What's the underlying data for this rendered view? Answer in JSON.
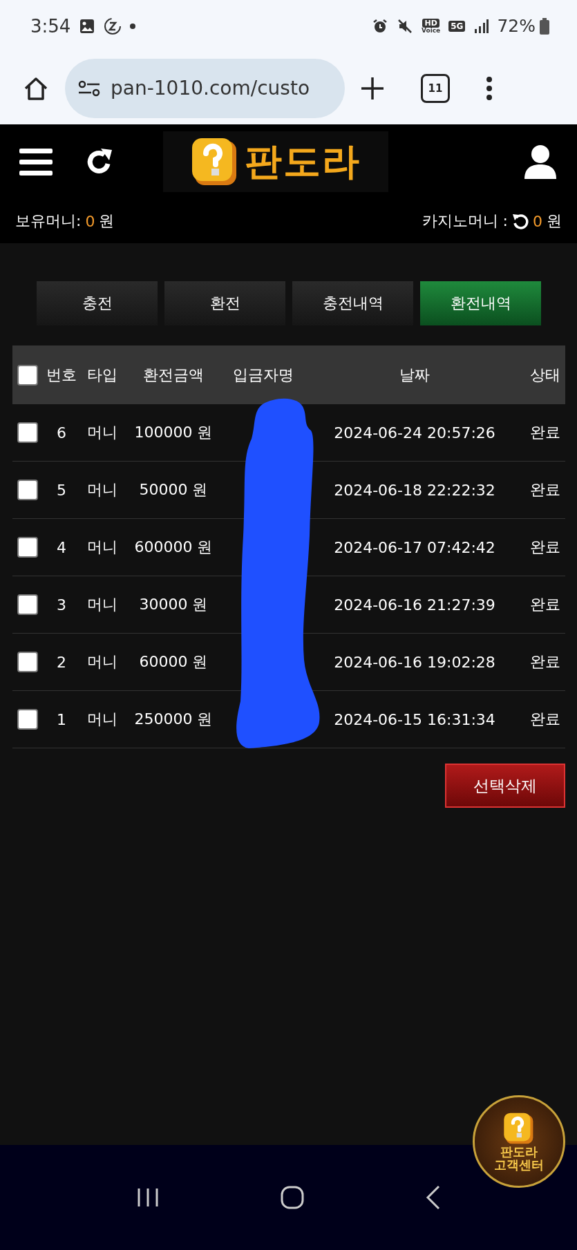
{
  "status_bar": {
    "time": "3:54",
    "hd": "HD",
    "voice": "Voice",
    "network": "5G",
    "battery": "72%"
  },
  "browser": {
    "url": "pan-1010.com/custo",
    "tab_count": "11"
  },
  "header": {
    "logo": "판도라"
  },
  "balances": {
    "holding_label": "보유머니:",
    "holding_value": "0",
    "holding_unit": "원",
    "casino_label": "카지노머니 :",
    "casino_value": "0",
    "casino_unit": "원"
  },
  "tabs": [
    {
      "label": "충전",
      "selected": false
    },
    {
      "label": "환전",
      "selected": false
    },
    {
      "label": "충전내역",
      "selected": false
    },
    {
      "label": "환전내역",
      "selected": true
    }
  ],
  "table": {
    "select_all_checked": false,
    "columns": [
      "번호",
      "타입",
      "환전금액",
      "입금자명",
      "날짜",
      "상태"
    ],
    "rows": [
      {
        "checked": false,
        "no": "6",
        "type": "머니",
        "amount": "100000 원",
        "date": "2024-06-24 20:57:26",
        "status": "완료"
      },
      {
        "checked": false,
        "no": "5",
        "type": "머니",
        "amount": "50000 원",
        "date": "2024-06-18 22:22:32",
        "status": "완료"
      },
      {
        "checked": false,
        "no": "4",
        "type": "머니",
        "amount": "600000 원",
        "date": "2024-06-17 07:42:42",
        "status": "완료"
      },
      {
        "checked": false,
        "no": "3",
        "type": "머니",
        "amount": "30000 원",
        "date": "2024-06-16 21:27:39",
        "status": "완료"
      },
      {
        "checked": false,
        "no": "2",
        "type": "머니",
        "amount": "60000 원",
        "date": "2024-06-16 19:02:28",
        "status": "완료"
      },
      {
        "checked": false,
        "no": "1",
        "type": "머니",
        "amount": "250000 원",
        "date": "2024-06-15 16:31:34",
        "status": "완료"
      }
    ]
  },
  "delete_button": "선택삭제",
  "support_badge": {
    "title": "판도라",
    "subtitle": "고객센터"
  }
}
